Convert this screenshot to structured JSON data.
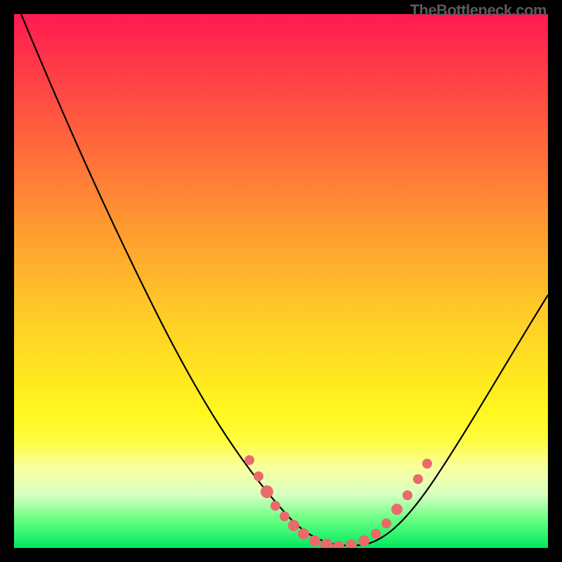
{
  "watermark": "TheBottleneck.com",
  "chart_data": {
    "type": "line",
    "title": "",
    "xlabel": "",
    "ylabel": "",
    "xlim": [
      0,
      100
    ],
    "ylim": [
      0,
      100
    ],
    "background": "red-yellow-green vertical gradient (high=red top, low=green bottom)",
    "series": [
      {
        "name": "bottleneck-curve",
        "x": [
          0,
          5,
          10,
          15,
          20,
          25,
          30,
          35,
          40,
          45,
          50,
          54,
          58,
          62,
          66,
          70,
          74,
          78,
          82,
          86,
          90,
          94,
          98,
          100
        ],
        "y": [
          100,
          92,
          84,
          75,
          67,
          58,
          49,
          40,
          31,
          22,
          13,
          6,
          2,
          0,
          0,
          2,
          7,
          14,
          22,
          30,
          37,
          44,
          50,
          53
        ]
      }
    ],
    "markers": {
      "name": "highlighted-points",
      "color": "#e86a6a",
      "points_x": [
        50,
        52,
        54,
        56,
        57,
        59,
        61,
        63,
        64,
        66,
        68,
        70,
        71,
        73,
        75,
        76
      ],
      "points_y": [
        13,
        10,
        6,
        4,
        3,
        2,
        1,
        0,
        0,
        0,
        2,
        3,
        5,
        8,
        11,
        13
      ]
    }
  }
}
